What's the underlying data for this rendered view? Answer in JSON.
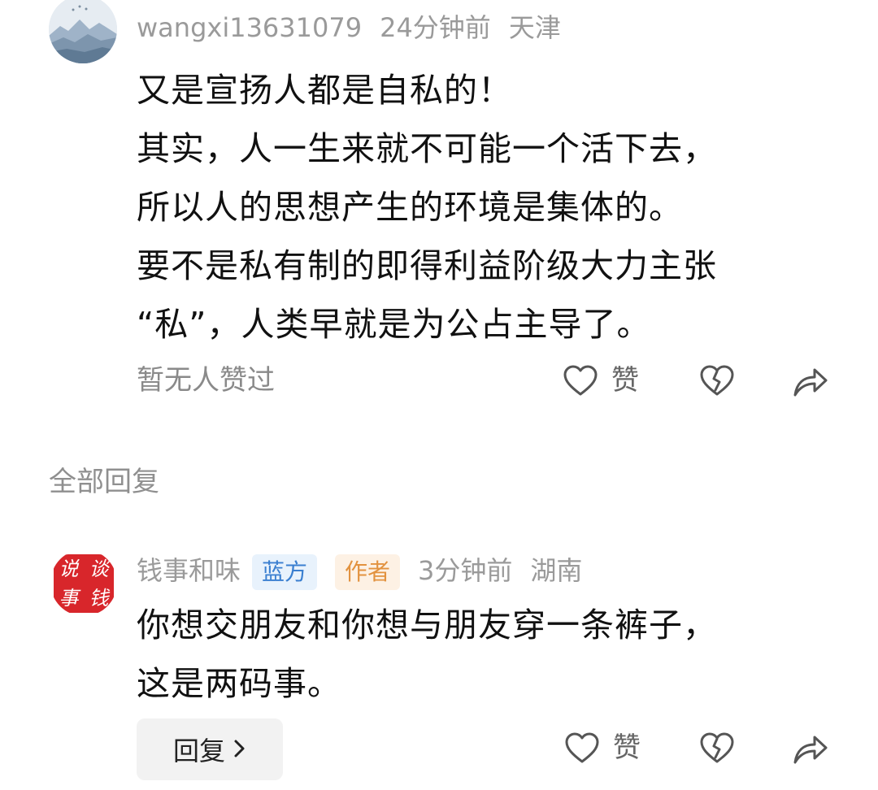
{
  "comment1": {
    "username": "wangxi13631079",
    "time": "24分钟前",
    "location": "天津",
    "lines": [
      "又是宣扬人都是自私的！",
      "其实，人一生来就不可能一个活下去，",
      "所以人的思想产生的环境是集体的。",
      "要不是私有制的即得利益阶级大力主张",
      "“私”，人类早就是为公占主导了。"
    ],
    "likes_status": "暂无人赞过",
    "like_label": "赞"
  },
  "section": {
    "title": "全部回复"
  },
  "comment2": {
    "username": "钱事和味",
    "badge_blue": "蓝方",
    "badge_author": "作者",
    "time": "3分钟前",
    "location": "湖南",
    "lines": [
      "你想交朋友和你想与朋友穿一条裤子，",
      "这是两码事。"
    ],
    "avatar_text": [
      "说",
      "谈",
      "事",
      "钱"
    ],
    "reply_label": "回复",
    "like_label": "赞"
  },
  "colors": {
    "meta_gray": "#9a9a9a",
    "badge_blue": "#3a7fd0",
    "badge_orange": "#e2923f",
    "avatar_red": "#d8262b"
  },
  "icons": [
    "heart-icon",
    "broken-heart-icon",
    "share-icon",
    "chevron-right-icon"
  ]
}
